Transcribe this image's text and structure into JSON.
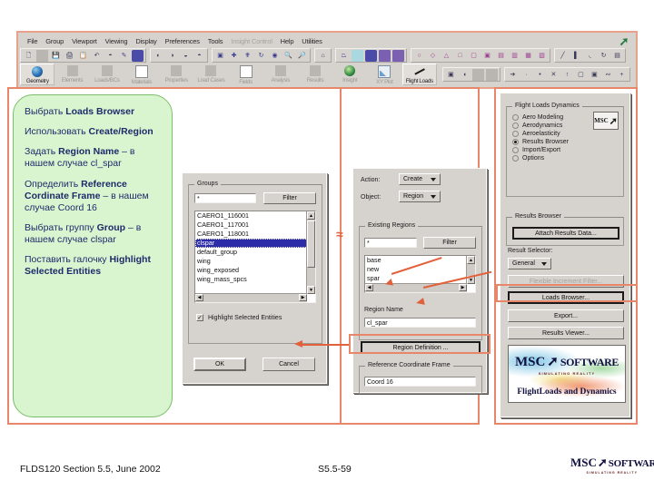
{
  "app": {
    "menu": [
      {
        "label": "File",
        "enabled": true
      },
      {
        "label": "Group",
        "enabled": true
      },
      {
        "label": "Viewport",
        "enabled": true
      },
      {
        "label": "Viewing",
        "enabled": true
      },
      {
        "label": "Display",
        "enabled": true
      },
      {
        "label": "Preferences",
        "enabled": true
      },
      {
        "label": "Tools",
        "enabled": true
      },
      {
        "label": "Insight Control",
        "enabled": false
      },
      {
        "label": "Help",
        "enabled": true
      },
      {
        "label": "Utilities",
        "enabled": true
      }
    ],
    "tabs": [
      {
        "label": "Geometry",
        "icon": "globe-icon",
        "active": true
      },
      {
        "label": "Elements",
        "icon": "square-icon",
        "active": false
      },
      {
        "label": "Loads/BCs",
        "icon": "square-icon",
        "active": false
      },
      {
        "label": "Materials",
        "icon": "square-icon",
        "active": false
      },
      {
        "label": "Properties",
        "icon": "square-icon",
        "active": false
      },
      {
        "label": "Load Cases",
        "icon": "square-icon",
        "active": false
      },
      {
        "label": "Fields",
        "icon": "grid-icon",
        "active": false
      },
      {
        "label": "Analysis",
        "icon": "square-icon",
        "active": false
      },
      {
        "label": "Results",
        "icon": "square-icon",
        "active": false
      },
      {
        "label": "Insight",
        "icon": "insight-globe-icon",
        "active": false
      },
      {
        "label": "XY Plot",
        "icon": "xy-plot-icon",
        "active": false
      },
      {
        "label": "Flight Loads",
        "icon": "flight-loads-icon",
        "active": true
      }
    ]
  },
  "callout": {
    "lines": [
      {
        "plain": "Выбрать ",
        "bold": "Loads Browser"
      },
      {
        "plain": "Использовать ",
        "bold": "Create/Region"
      },
      {
        "plain": "Задать ",
        "bold": "Region Name",
        "tail": " – в нашем случае cl_spar"
      },
      {
        "plain": "Определить ",
        "bold": "Reference Cordinate Frame",
        "tail": " – в нашем случае Coord 16"
      },
      {
        "plain": "Выбрать группу ",
        "bold": "Group",
        "tail": " – в нашем случае clspar"
      },
      {
        "plain": "Поставить галочку ",
        "bold": "Highlight Selected Entities"
      }
    ]
  },
  "groups_dialog": {
    "group_title": "Groups",
    "filter_value": "*",
    "filter_button": "Filter",
    "items": [
      "CAERO1_116001",
      "CAERO1_117001",
      "CAERO1_118001",
      "clspar",
      "default_group",
      "wing",
      "wing_exposed",
      "wing_mass_spcs"
    ],
    "selected_item": "clspar",
    "checkbox_label": "Highlight Selected Entities",
    "checkbox_checked": true,
    "ok_button": "OK",
    "cancel_button": "Cancel"
  },
  "region_form": {
    "action_label": "Action:",
    "action_value": "Create",
    "object_label": "Object:",
    "object_value": "Region",
    "existing_title": "Existing Regions",
    "existing_filter_value": "*",
    "existing_filter_button": "Filter",
    "existing_items": [
      "base",
      "new",
      "spar"
    ],
    "region_name_label": "Region Name",
    "region_name_value": "cl_spar",
    "region_definition_button": "Region Definition ...",
    "ref_frame_label": "Reference Coordinate Frame",
    "ref_frame_value": "Coord 16"
  },
  "flight_loads_panel": {
    "group_title": "Flight Loads  Dynamics",
    "logo_text": "MSC",
    "radios": [
      {
        "label": "Aero Modeling",
        "selected": false
      },
      {
        "label": "Aerodynamics",
        "selected": false
      },
      {
        "label": "Aeroelasticity",
        "selected": false
      },
      {
        "label": "Results Browser",
        "selected": true
      },
      {
        "label": "Import/Export",
        "selected": false
      },
      {
        "label": "Options",
        "selected": false
      }
    ],
    "results_browser_title": "Results Browser",
    "attach_button": "Attach Results Data...",
    "result_selector_label": "Result Selector:",
    "result_selector_value": "General",
    "buttons": [
      {
        "label": "Flexible Increment Filter...",
        "enabled": false,
        "highlighted": false
      },
      {
        "label": "Loads Browser...",
        "enabled": true,
        "highlighted": true
      },
      {
        "label": "Export...",
        "enabled": true,
        "highlighted": false
      },
      {
        "label": "Results Viewer...",
        "enabled": true,
        "highlighted": false
      }
    ],
    "logo": {
      "brand_msc": "MSC",
      "brand_software": "SOFTWARE",
      "tagline": "SIMULATING REALITY",
      "product": "FlightLoads and Dynamics"
    }
  },
  "footer": {
    "left": "FLDS120 Section 5.5, June 2002",
    "center": "S5.5-59",
    "logo_msc": "MSC",
    "logo_software": "SOFTWARE",
    "logo_tagline": "SIMULATING REALITY"
  }
}
